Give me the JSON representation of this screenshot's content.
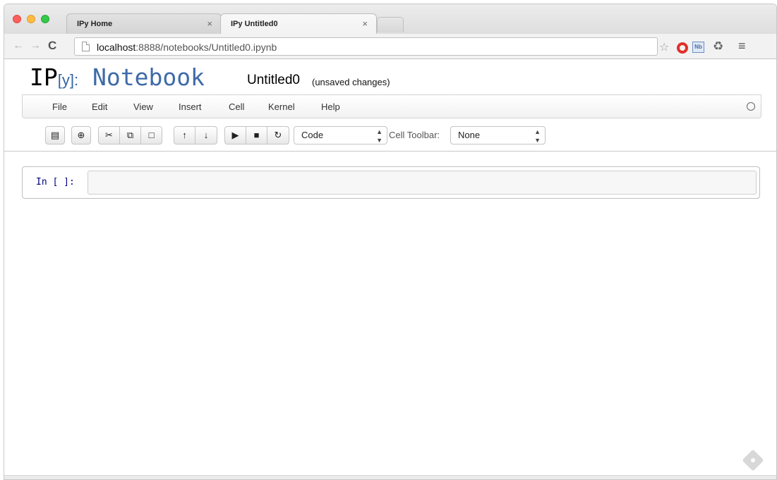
{
  "browser": {
    "tabs": [
      {
        "label": "IPy Home",
        "close": "×"
      },
      {
        "label": "IPy Untitled0",
        "close": "×"
      }
    ],
    "address": {
      "host": "localhost",
      "path": ":8888/notebooks/Untitled0.ipynb"
    },
    "icons": {
      "back": "back-arrow-icon",
      "forward": "forward-arrow-icon",
      "reload": "reload-icon",
      "bookmark": "star-icon",
      "opera": "opera-icon",
      "notebook_ext": "nb-extension-icon",
      "recycle": "recycle-icon",
      "menu": "hamburger-menu-icon"
    },
    "nb_ext_text": "Nb"
  },
  "notebook": {
    "logo": {
      "ip": "IP",
      "y": "[y]",
      "colon": ":",
      "word": "Notebook"
    },
    "name": "Untitled0",
    "status": "(unsaved changes)",
    "menu": [
      "File",
      "Edit",
      "View",
      "Insert",
      "Cell",
      "Kernel",
      "Help"
    ],
    "toolbar": {
      "cell_type": "Code",
      "cell_toolbar_label": "Cell Toolbar:",
      "cell_toolbar_value": "None"
    },
    "cell": {
      "prompt": "In [ ]:"
    }
  },
  "colors": {
    "prompt": "#000080",
    "logo_blue": "#3e6aa8",
    "close_red": "#fc605c",
    "minimize_yellow": "#fdbc40",
    "zoom_green": "#34c84a"
  }
}
